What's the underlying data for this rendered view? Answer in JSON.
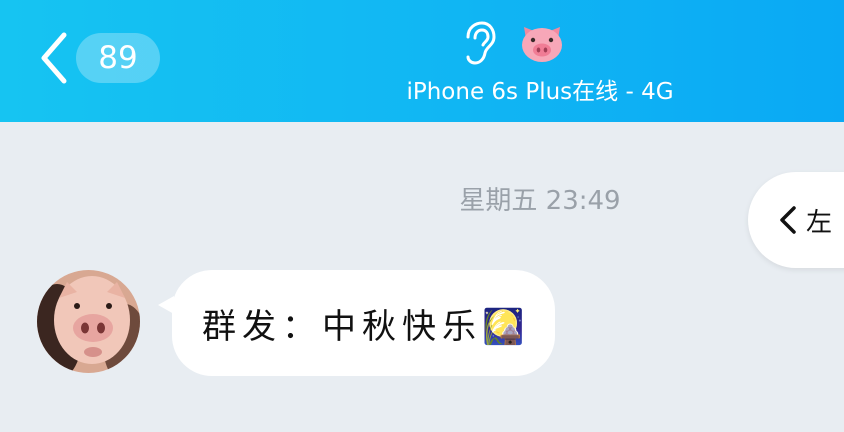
{
  "header": {
    "back_count": "89",
    "online_status": "iPhone 6s Plus在线 - 4G",
    "icons": [
      "ear-icon",
      "pig-emoji-icon"
    ]
  },
  "chat": {
    "timestamp": "星期五 23:49",
    "side_pill_label": "左",
    "messages": [
      {
        "sender_avatar": "pig-avatar",
        "text": "群发：中秋快乐🎑"
      }
    ]
  },
  "colors": {
    "header_start": "#16c4f2",
    "header_end": "#0aa9f4",
    "background": "#e8edf2",
    "bubble": "#ffffff",
    "timestamp_text": "#9aa1a9"
  }
}
